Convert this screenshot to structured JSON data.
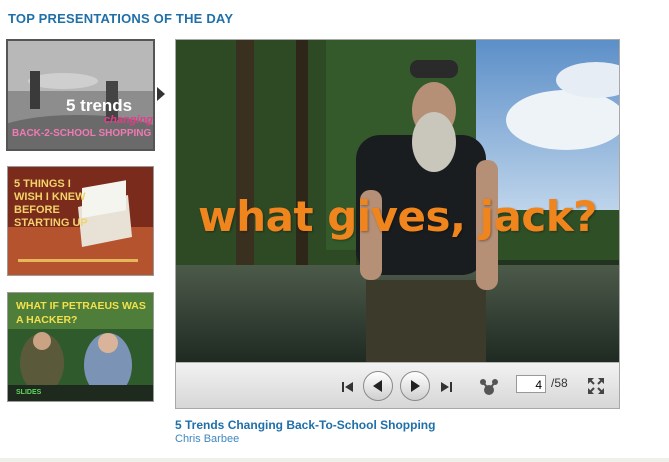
{
  "header": {
    "title": "TOP PRESENTATIONS OF THE DAY"
  },
  "thumbnails": [
    {
      "line1": "5 trends",
      "line2": "changing",
      "line3": "BACK-2-SCHOOL SHOPPING"
    },
    {
      "line1": "5 THINGS I",
      "line2": "WISH I KNEW",
      "line3": "BEFORE",
      "line4": "STARTING UP"
    },
    {
      "line1": "WHAT IF PETRAEUS WAS",
      "line2": "A HACKER?",
      "brand": "SLIDES"
    }
  ],
  "player": {
    "slide_caption": "what gives, jack?",
    "current_page": "4",
    "total_pages": "/58"
  },
  "presentation": {
    "title": "5 Trends Changing Back-To-School Shopping",
    "author": "Chris Barbee"
  },
  "icons": [
    "first-slide-icon",
    "previous-icon",
    "next-icon",
    "last-slide-icon",
    "share-icon",
    "fullscreen-icon"
  ],
  "colors": {
    "link_blue": "#1f6fa8",
    "caption_orange": "#f0851d"
  }
}
